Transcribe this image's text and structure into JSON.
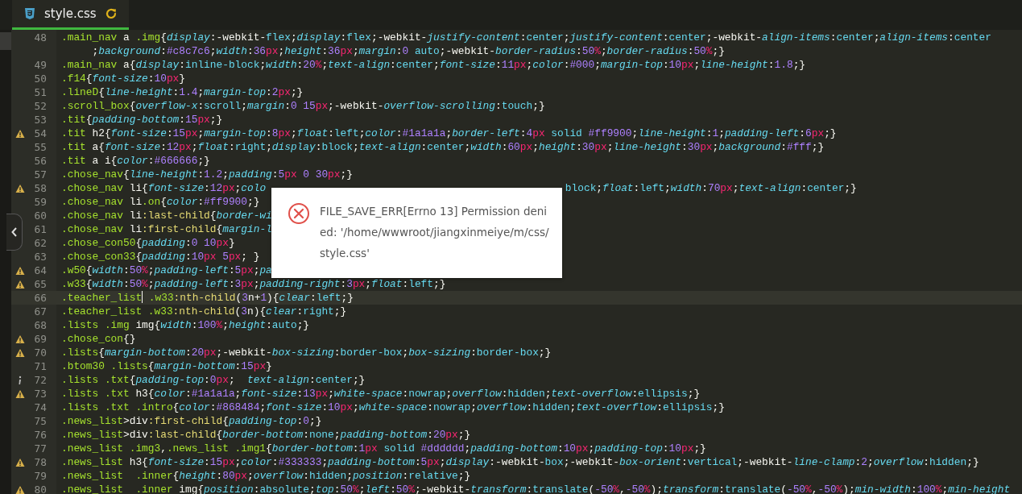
{
  "tabs": [
    {
      "label": "style.css",
      "selected": true,
      "modified": true
    }
  ],
  "editor": {
    "lines": [
      {
        "number": "48",
        "text": ".main_nav a .img{display:-webkit-flex;display:flex;-webkit-justify-content:center;justify-content:center;-webkit-align-items:center;align-items:center",
        "continuation": ";background:#c8c7c6;width:36px;height:36px;margin:0 auto;-webkit-border-radius:50%;border-radius:50%;}"
      },
      {
        "number": "49",
        "text": ".main_nav a{display:inline-block;width:20%;text-align:center;font-size:11px;color:#000;margin-top:10px;line-height:1.8;}"
      },
      {
        "number": "50",
        "text": ".f14{font-size:10px}"
      },
      {
        "number": "51",
        "text": ".lineD{line-height:1.4;margin-top:2px;}"
      },
      {
        "number": "52",
        "text": ".scroll_box{overflow-x:scroll;margin:0 15px;-webkit-overflow-scrolling:touch;}"
      },
      {
        "number": "53",
        "text": ".tit{padding-bottom:15px;}"
      },
      {
        "number": "54",
        "warning": true,
        "text": ".tit h2{font-size:15px;margin-top:8px;float:left;color:#1a1a1a;border-left:4px solid #ff9900;line-height:1;padding-left:6px;}"
      },
      {
        "number": "55",
        "text": ".tit a{font-size:12px;float:right;display:block;text-align:center;width:60px;height:30px;line-height:30px;background:#fff;}"
      },
      {
        "number": "56",
        "text": ".tit a i{color:#666666;}"
      },
      {
        "number": "57",
        "text": ".chose_nav{line-height:1.2;padding:5px 0 30px;}"
      },
      {
        "number": "58",
        "warning": true,
        "text": ".chose_nav li{font-size:12px;colo",
        "tail": "block;float:left;width:70px;text-align:center;}"
      },
      {
        "number": "59",
        "text": ".chose_nav li.on{color:#ff9900;}"
      },
      {
        "number": "60",
        "text": ".chose_nav li:last-child{border-wi"
      },
      {
        "number": "61",
        "text": ".chose_nav li:first-child{margin-l"
      },
      {
        "number": "62",
        "text": ".chose_con50{padding:0 10px}"
      },
      {
        "number": "63",
        "text": ".chose_con33{padding:10px 5px; }"
      },
      {
        "number": "64",
        "warning": true,
        "text": ".w50{width:50%;padding-left:5px;pa"
      },
      {
        "number": "65",
        "warning": true,
        "text": ".w33{width:50%;padding-left:3px;padding-right:3px;float:left;}"
      },
      {
        "number": "66",
        "current": true,
        "text": ".teacher_list",
        "after_cursor": " .w33:nth-child(3n+1){clear:left;}"
      },
      {
        "number": "67",
        "text": ".teacher_list .w33:nth-child(3n){clear:right;}"
      },
      {
        "number": "68",
        "text": ".lists .img img{width:100%;height:auto;}"
      },
      {
        "number": "69",
        "warning": true,
        "text": ".chose_con{}"
      },
      {
        "number": "70",
        "warning": true,
        "text": ".lists{margin-bottom:20px;-webkit-box-sizing:border-box;box-sizing:border-box;}"
      },
      {
        "number": "71",
        "text": ".btom30 .lists{margin-bottom:15px}"
      },
      {
        "number": "72",
        "info": true,
        "text": ".lists .txt{padding-top:0px;  text-align:center;}"
      },
      {
        "number": "73",
        "warning": true,
        "text": ".lists .txt h3{color:#1a1a1a;font-size:13px;white-space:nowrap;overflow:hidden;text-overflow:ellipsis;}"
      },
      {
        "number": "74",
        "text": ".lists .txt .intro{color:#868484;font-size:10px;white-space:nowrap;overflow:hidden;text-overflow:ellipsis;}"
      },
      {
        "number": "75",
        "text": ".news_list>div:first-child{padding-top:0;}"
      },
      {
        "number": "76",
        "text": ".news_list>div:last-child{border-bottom:none;padding-bottom:20px;}"
      },
      {
        "number": "77",
        "text": ".news_list .img3,.news_list .img1{border-bottom:1px solid #dddddd;padding-bottom:10px;padding-top:10px;}"
      },
      {
        "number": "78",
        "warning": true,
        "text": ".news_list h3{font-size:15px;color:#333333;padding-bottom:5px;display:-webkit-box;-webkit-box-orient:vertical;-webkit-line-clamp:2;overflow:hidden;}"
      },
      {
        "number": "79",
        "text": ".news_list  .inner{height:80px;overflow:hidden;position:relative;}"
      },
      {
        "number": "80",
        "warning": true,
        "text": ".news_list  .inner img{position:absolute;top:50%;left:50%;-webkit-transform:translate(-50%,-50%);transform:translate(-50%,-50%);min-width:100%;min-height"
      }
    ]
  },
  "dialog": {
    "kind": "error",
    "message": "FILE_SAVE_ERR[Errno 13] Permission denied: '/home/wwwroot/jiangxinmeiye/m/css/style.css'"
  }
}
